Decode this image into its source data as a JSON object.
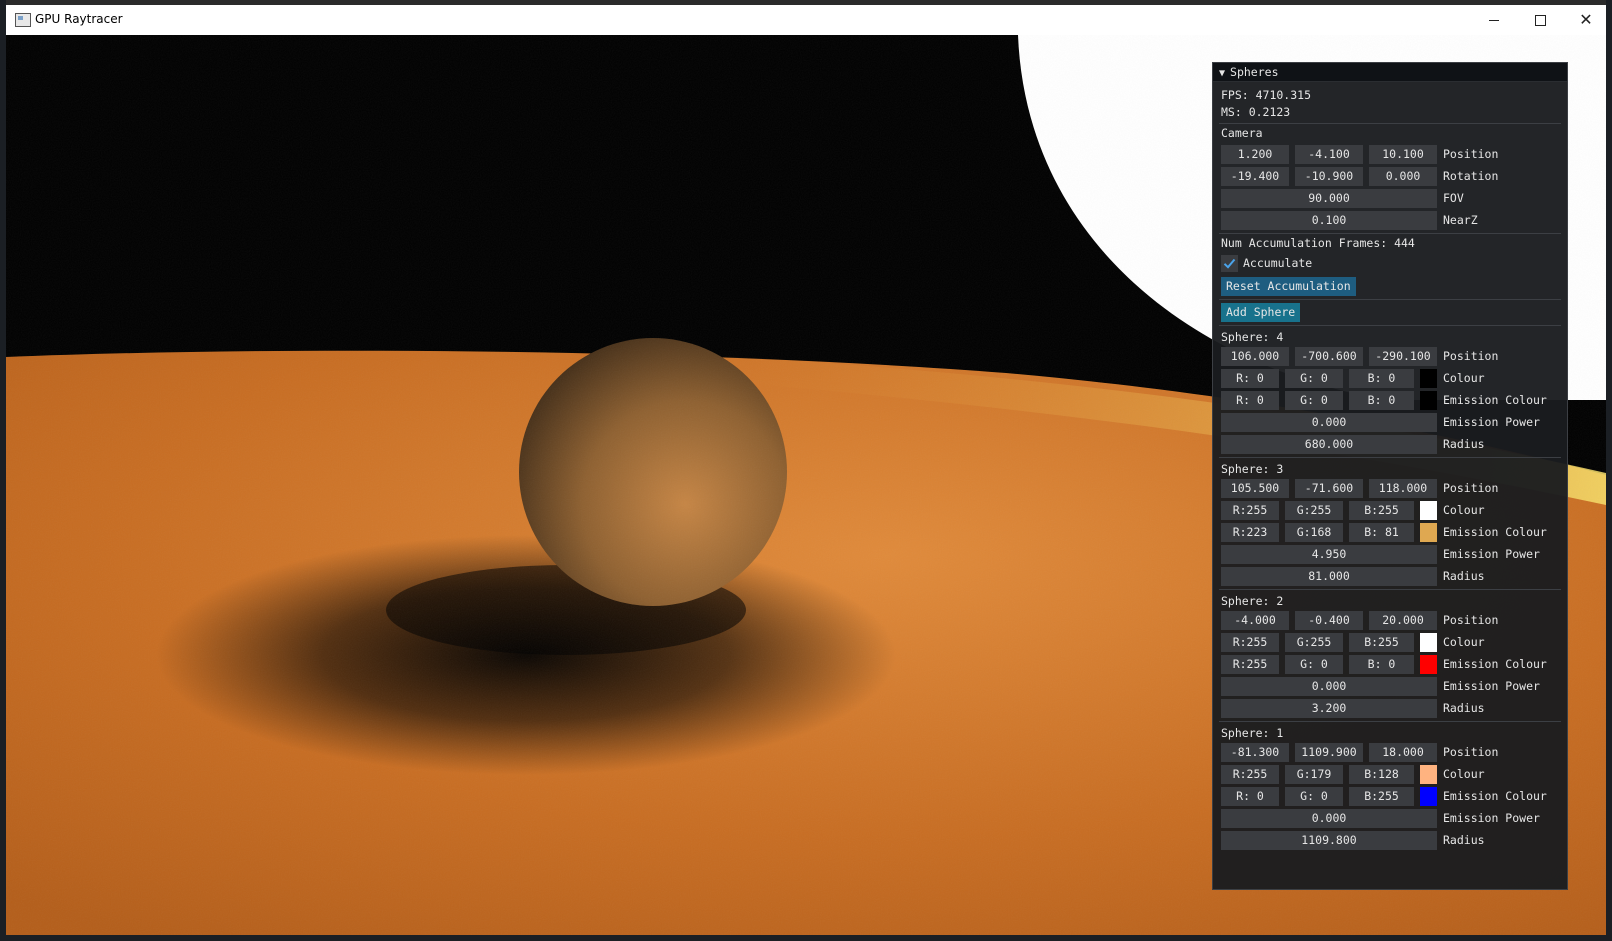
{
  "window": {
    "title": "GPU Raytracer"
  },
  "panel": {
    "title": "Spheres",
    "fps": "FPS: 4710.315",
    "ms": "MS: 0.2123",
    "camera": {
      "heading": "Camera",
      "position": [
        "1.200",
        "-4.100",
        "10.100"
      ],
      "position_label": "Position",
      "rotation": [
        "-19.400",
        "-10.900",
        "0.000"
      ],
      "rotation_label": "Rotation",
      "fov": "90.000",
      "fov_label": "FOV",
      "nearz": "0.100",
      "nearz_label": "NearZ"
    },
    "accumulation_frames": "Num Accumulation Frames: 444",
    "accumulate_label": "Accumulate",
    "accumulate_checked": true,
    "reset_button": "Reset Accumulation",
    "add_button": "Add Sphere",
    "labels": {
      "position": "Position",
      "colour": "Colour",
      "emission_colour": "Emission Colour",
      "emission_power": "Emission Power",
      "radius": "Radius"
    },
    "spheres": [
      {
        "title": "Sphere: 4",
        "position": [
          "106.000",
          "-700.600",
          "-290.100"
        ],
        "colour": [
          "R:  0",
          "G:  0",
          "B:  0"
        ],
        "colour_hex": "#000000",
        "emission": [
          "R:  0",
          "G:  0",
          "B:  0"
        ],
        "emission_hex": "#000000",
        "emission_power": "0.000",
        "radius": "680.000"
      },
      {
        "title": "Sphere: 3",
        "position": [
          "105.500",
          "-71.600",
          "118.000"
        ],
        "colour": [
          "R:255",
          "G:255",
          "B:255"
        ],
        "colour_hex": "#ffffff",
        "emission": [
          "R:223",
          "G:168",
          "B: 81"
        ],
        "emission_hex": "#dfa851",
        "emission_power": "4.950",
        "radius": "81.000"
      },
      {
        "title": "Sphere: 2",
        "position": [
          "-4.000",
          "-0.400",
          "20.000"
        ],
        "colour": [
          "R:255",
          "G:255",
          "B:255"
        ],
        "colour_hex": "#ffffff",
        "emission": [
          "R:255",
          "G:  0",
          "B:  0"
        ],
        "emission_hex": "#ff0000",
        "emission_power": "0.000",
        "radius": "3.200"
      },
      {
        "title": "Sphere: 1",
        "position": [
          "-81.300",
          "1109.900",
          "18.000"
        ],
        "colour": [
          "R:255",
          "G:179",
          "B:128"
        ],
        "colour_hex": "#ffb380",
        "emission": [
          "R:  0",
          "G:  0",
          "B:255"
        ],
        "emission_hex": "#0000ff",
        "emission_power": "0.000",
        "radius": "1109.800"
      }
    ]
  }
}
